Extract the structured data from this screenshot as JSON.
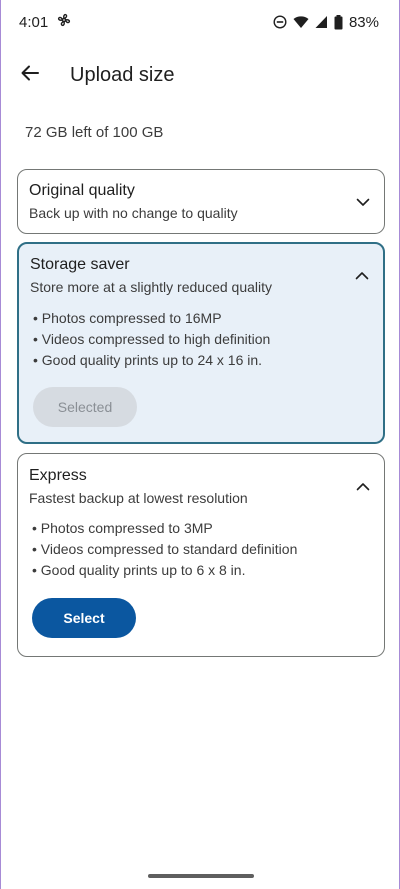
{
  "status_bar": {
    "time": "4:01",
    "battery": "83%",
    "icons": [
      "fan-icon",
      "do-not-disturb-icon",
      "wifi-icon",
      "signal-icon",
      "battery-icon"
    ]
  },
  "app_bar": {
    "title": "Upload size",
    "back_icon": "arrow-back-icon"
  },
  "storage_summary": "72 GB left of 100 GB",
  "options": [
    {
      "title": "Original quality",
      "subtitle": "Back up with no change to quality",
      "expanded": false,
      "selected": false
    },
    {
      "title": "Storage saver",
      "subtitle": "Store more at a slightly reduced quality",
      "expanded": true,
      "selected": true,
      "bullets": [
        "• Photos compressed to 16MP",
        "• Videos compressed to high definition",
        "• Good quality prints up to 24 x 16 in."
      ],
      "button_label": "Selected"
    },
    {
      "title": "Express",
      "subtitle": "Fastest backup at lowest resolution",
      "expanded": true,
      "selected": false,
      "bullets": [
        "• Photos compressed to 3MP",
        "• Videos compressed to standard definition",
        "• Good quality prints up to 6 x 8 in."
      ],
      "button_label": "Select"
    }
  ],
  "colors": {
    "accent": "#0b57a0",
    "selected_border": "#2f6f86",
    "selected_background": "#e8f0f8",
    "disabled_button": "#d6dbe1"
  }
}
